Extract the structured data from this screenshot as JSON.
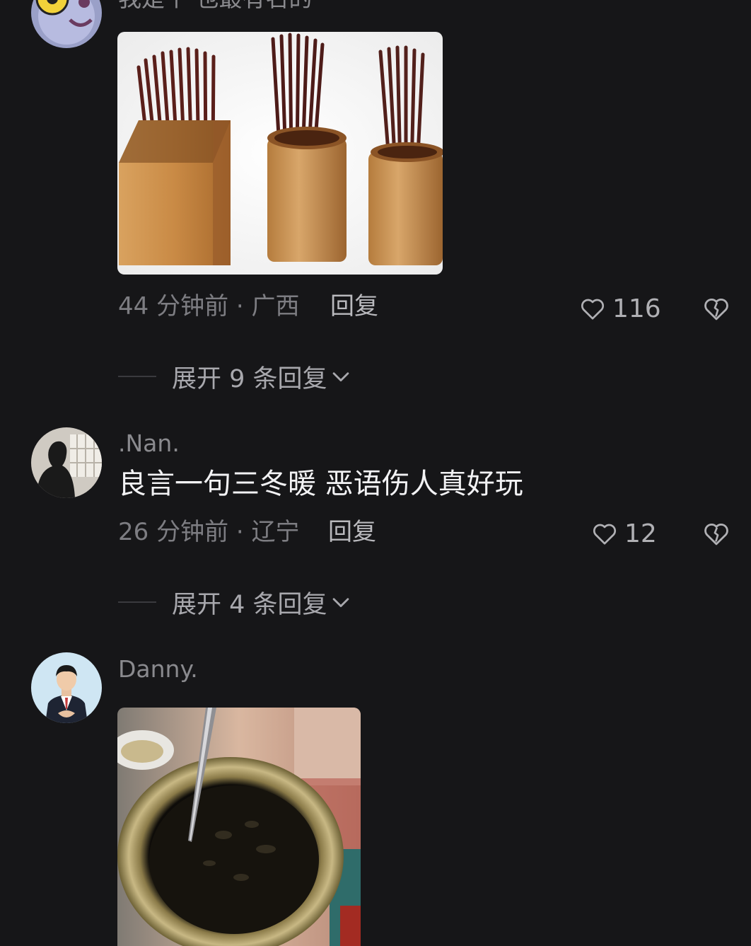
{
  "comments": [
    {
      "username": "我是个·也最有名的",
      "text": "",
      "time_location": "44 分钟前 · 广西",
      "reply_label": "回复",
      "like_count": "116",
      "expand_label": "展开 9 条回复"
    },
    {
      "username": ".Nan.",
      "text": "良言一句三冬暖 恶语伤人真好玩",
      "time_location": "26 分钟前 · 辽宁",
      "reply_label": "回复",
      "like_count": "12",
      "expand_label": "展开 4 条回复"
    },
    {
      "username": "Danny.",
      "text": ""
    }
  ],
  "icons": {
    "like": "heart-outline-icon",
    "dislike": "broken-heart-icon",
    "expand": "chevron-down-icon"
  },
  "colors": {
    "background": "#161618",
    "primary_text": "#f2f2f4",
    "secondary_text": "#7d7d82"
  }
}
